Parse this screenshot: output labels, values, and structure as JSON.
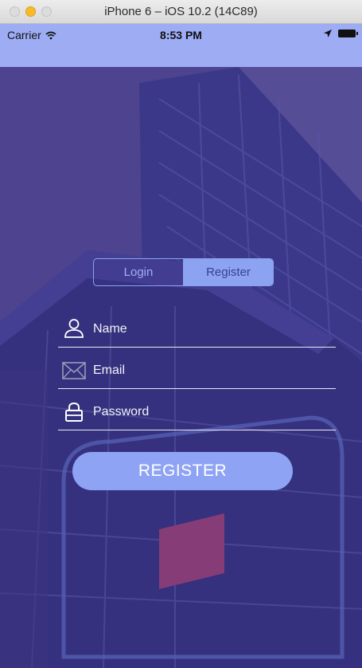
{
  "window": {
    "title": "iPhone 6 – iOS 10.2 (14C89)"
  },
  "status_bar": {
    "carrier": "Carrier",
    "time": "8:53 PM"
  },
  "segmented_control": {
    "options": [
      {
        "label": "Login",
        "selected": false
      },
      {
        "label": "Register",
        "selected": true
      }
    ]
  },
  "form": {
    "name": {
      "placeholder": "Name",
      "value": "",
      "icon": "person-icon"
    },
    "email": {
      "placeholder": "Email",
      "value": "",
      "icon": "envelope-icon"
    },
    "password": {
      "placeholder": "Password",
      "value": "",
      "icon": "lock-icon"
    }
  },
  "register_button": {
    "label": "REGISTER"
  },
  "colors": {
    "status_bar_bg": "#9eacf4",
    "overlay": "#3f3796",
    "accent": "#8ba3f1",
    "button_bg": "#8fa3f5",
    "text_light": "#ffffff"
  }
}
